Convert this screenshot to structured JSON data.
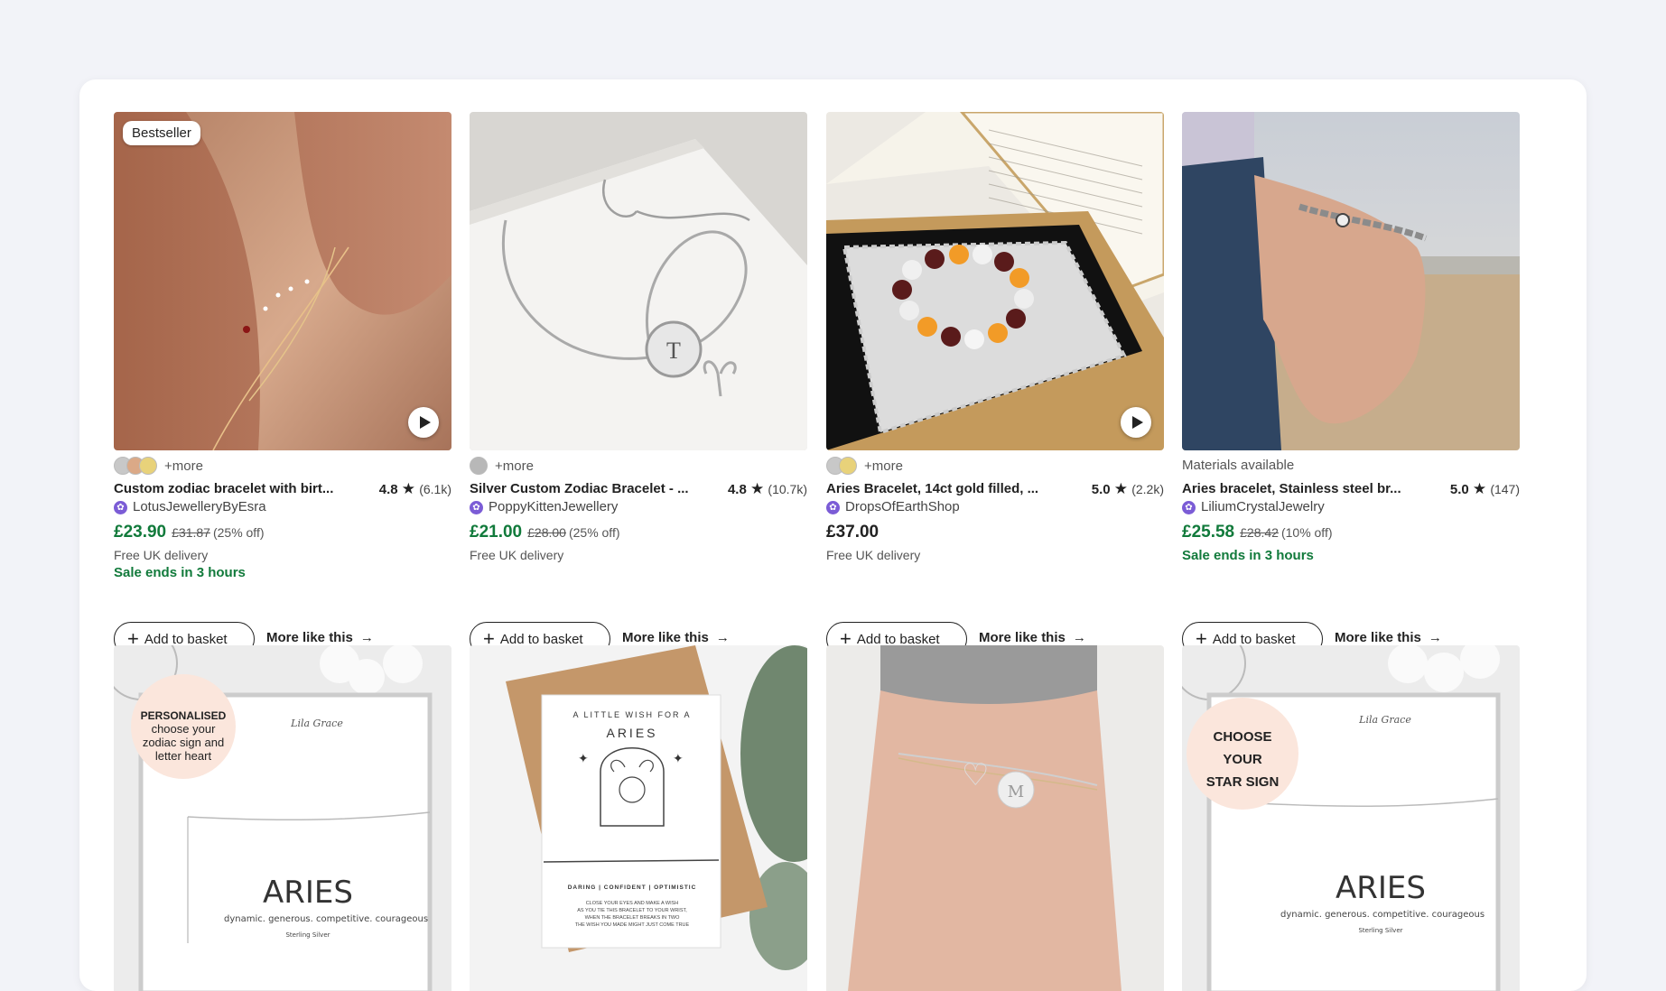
{
  "products": [
    {
      "badge": "Bestseller",
      "swatch_colors": [
        "#c8c8c8",
        "#e0c07a",
        "#e8d27a"
      ],
      "more": "+more",
      "title": "Custom zodiac bracelet with birt...",
      "rating": "4.8",
      "star": "★",
      "reviews": "(6.1k)",
      "shop": "LotusJewelleryByEsra",
      "price": "£23.90",
      "original_price": "£31.87",
      "discount": "(25% off)",
      "delivery": "Free UK delivery",
      "sale": "Sale ends in 3 hours",
      "add_label": "Add to basket",
      "more_like": "More like this",
      "has_video": true
    },
    {
      "swatch_colors": [
        "#b8b8b8"
      ],
      "more": "+more",
      "title": "Silver Custom Zodiac Bracelet - ...",
      "rating": "4.8",
      "star": "★",
      "reviews": "(10.7k)",
      "shop": "PoppyKittenJewellery",
      "price": "£21.00",
      "original_price": "£28.00",
      "discount": "(25% off)",
      "delivery": "Free UK delivery",
      "add_label": "Add to basket",
      "more_like": "More like this"
    },
    {
      "swatch_colors": [
        "#c8c8c8",
        "#e8d27a"
      ],
      "more": "+more",
      "title": "Aries Bracelet, 14ct gold filled, ...",
      "rating": "5.0",
      "star": "★",
      "reviews": "(2.2k)",
      "shop": "DropsOfEarthShop",
      "price": "£37.00",
      "delivery": "Free UK delivery",
      "add_label": "Add to basket",
      "more_like": "More like this",
      "has_video": true
    },
    {
      "materials": "Materials available",
      "title": "Aries bracelet, Stainless steel br...",
      "rating": "5.0",
      "star": "★",
      "reviews": "(147)",
      "shop": "LiliumCrystalJewelry",
      "price": "£25.58",
      "original_price": "£28.42",
      "discount": "(10% off)",
      "sale": "Sale ends in 3 hours",
      "add_label": "Add to basket",
      "more_like": "More like this"
    }
  ],
  "second_row": [
    {
      "brand": "Lila Grace",
      "callout": [
        "PERSONALISED",
        "choose your",
        "zodiac sign and",
        "letter heart"
      ],
      "sign": "ARIES",
      "traits": "dynamic. generous. competitive. courageous",
      "metal": "Sterling Silver"
    },
    {
      "card_heading": "A LITTLE WISH FOR A",
      "sign": "ARIES",
      "traits": "DARING | CONFIDENT | OPTIMISTIC",
      "verse": [
        "CLOSE YOUR EYES AND MAKE A WISH",
        "AS YOU TIE THIS BRACELET TO YOUR WRIST,",
        "WHEN THE BRACELET BREAKS IN TWO",
        "THE WISH YOU MADE MIGHT JUST COME TRUE"
      ]
    },
    {
      "charm_letter": "M"
    },
    {
      "brand": "Lila Grace",
      "callout": [
        "CHOOSE",
        "YOUR",
        "STAR SIGN"
      ],
      "sign": "ARIES",
      "traits": "dynamic. generous. competitive. courageous",
      "metal": "Sterling Silver"
    }
  ]
}
